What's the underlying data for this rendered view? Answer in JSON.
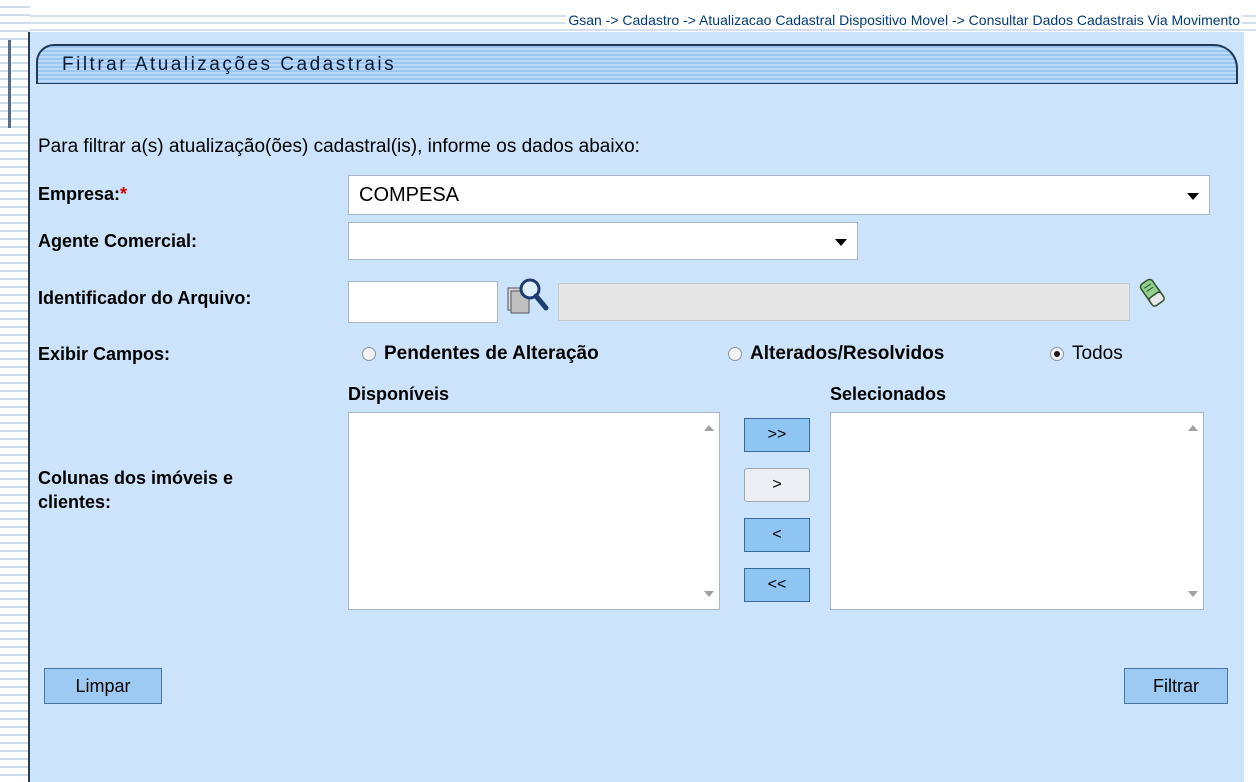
{
  "breadcrumb": "Gsan -> Cadastro -> Atualizacao Cadastral Dispositivo Movel -> Consultar Dados Cadastrais Via Movimento",
  "panel": {
    "title": "Filtrar Atualizações Cadastrais"
  },
  "intro": "Para filtrar a(s) atualização(ões) cadastral(is), informe os dados abaixo:",
  "form": {
    "empresa": {
      "label": "Empresa:",
      "required_mark": "*",
      "value": "COMPESA"
    },
    "agente": {
      "label": "Agente Comercial:",
      "value": ""
    },
    "arquivo": {
      "label": "Identificador do Arquivo:",
      "value": "",
      "description": ""
    },
    "exibir": {
      "label": "Exibir Campos:",
      "options": [
        "Pendentes de Alteração",
        "Alterados/Resolvidos",
        "Todos"
      ],
      "selected": "Todos"
    },
    "colunas": {
      "label_line1": "Colunas dos imóveis e",
      "label_line2": "clientes:",
      "available_header": "Disponíveis",
      "selected_header": "Selecionados",
      "move_all_right": ">>",
      "move_right": ">",
      "move_left": "<",
      "move_all_left": "<<"
    }
  },
  "buttons": {
    "clear": "Limpar",
    "filter": "Filtrar"
  },
  "icons": {
    "search": "magnifier-search-icon",
    "erase": "eraser-icon"
  },
  "colors": {
    "panel_bg": "#cce4fb",
    "button_bg": "#9ccaf2",
    "header_border": "#1f3855"
  }
}
